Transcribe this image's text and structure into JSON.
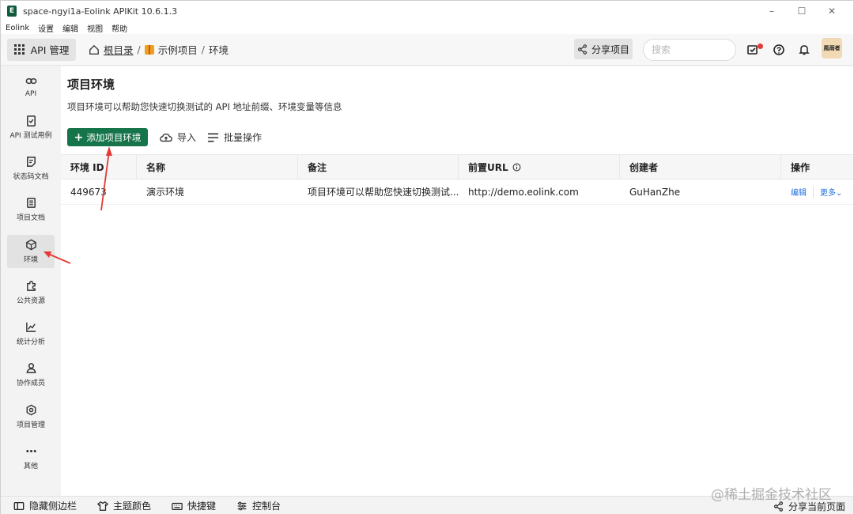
{
  "window": {
    "title": "space-ngyi1a-Eolink APIKit 10.6.1.3",
    "controls": [
      "–",
      "☐",
      "✕"
    ]
  },
  "menubar": {
    "items": [
      "Eolink",
      "设置",
      "编辑",
      "视图",
      "帮助"
    ]
  },
  "topnav": {
    "module_label": "API 管理",
    "breadcrumb": {
      "root": "根目录",
      "sep1": "/",
      "project": "示例项目",
      "sep2": "/",
      "current": "环境"
    },
    "share_label": "分享项目",
    "search_placeholder": "搜索",
    "avatar_text": "風雨者"
  },
  "sidebar": {
    "items": [
      {
        "label": "API",
        "icon": "link-icon"
      },
      {
        "label": "API 测试用例",
        "icon": "clipboard-check-icon"
      },
      {
        "label": "状态码文档",
        "icon": "note-icon"
      },
      {
        "label": "项目文档",
        "icon": "document-icon"
      },
      {
        "label": "环境",
        "icon": "cube-icon"
      },
      {
        "label": "公共资源",
        "icon": "puzzle-icon"
      },
      {
        "label": "统计分析",
        "icon": "chart-icon"
      },
      {
        "label": "协作成员",
        "icon": "member-icon"
      },
      {
        "label": "项目管理",
        "icon": "settings-icon"
      },
      {
        "label": "其他",
        "icon": "more-icon"
      }
    ],
    "active": "环境"
  },
  "main": {
    "title": "项目环境",
    "description": "项目环境可以帮助您快速切换测试的 API 地址前缀、环境变量等信息",
    "add_button": "添加项目环境",
    "import_label": "导入",
    "batch_label": "批量操作",
    "table": {
      "headers": [
        "环境 ID",
        "名称",
        "备注",
        "前置URL",
        "创建者",
        "操作"
      ],
      "rows": [
        {
          "id": "449673",
          "name": "演示环境",
          "note": "项目环境可以帮助您快速切换测试...",
          "url": "http://demo.eolink.com",
          "creator": "GuHanZhe",
          "edit": "编辑",
          "more": "更多"
        }
      ]
    }
  },
  "statusbar": {
    "hide_sidebar": "隐藏侧边栏",
    "theme_color": "主题颜色",
    "shortcuts": "快捷键",
    "console": "控制台",
    "share_page": "分享当前页面"
  },
  "watermark": "@稀土掘金技术社区",
  "colors": {
    "primary": "#16744a",
    "link": "#1e6fd9",
    "annotation": "#e53935"
  }
}
